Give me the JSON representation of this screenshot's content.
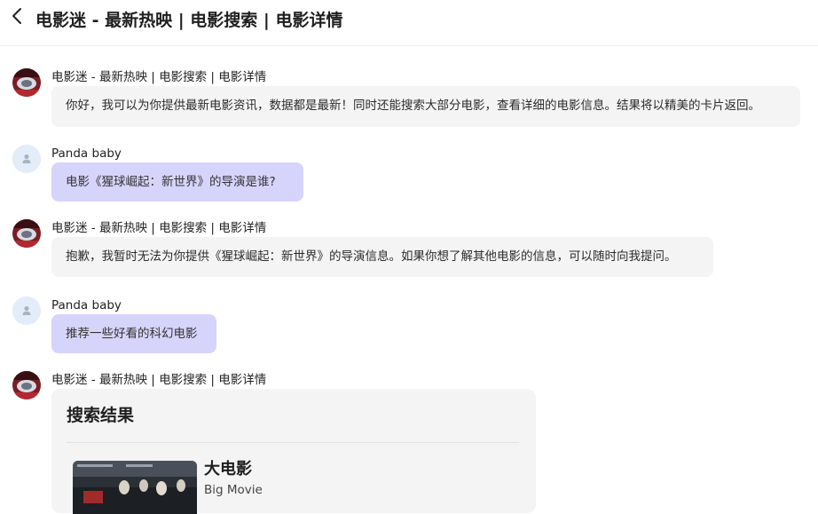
{
  "header": {
    "title": "电影迷 - 最新热映 | 电影搜索 | 电影详情"
  },
  "messages": [
    {
      "sender": "电影迷 - 最新热映 | 电影搜索 | 电影详情",
      "text": "你好，我可以为你提供最新电影资讯，数据都是最新！同时还能搜索大部分电影，查看详细的电影信息。结果将以精美的卡片返回。"
    },
    {
      "sender": "Panda baby",
      "text": "电影《猩球崛起：新世界》的导演是谁?"
    },
    {
      "sender": "电影迷 - 最新热映 | 电影搜索 | 电影详情",
      "text": "抱歉，我暂时无法为你提供《猩球崛起：新世界》的导演信息。如果你想了解其他电影的信息，可以随时向我提问。"
    },
    {
      "sender": "Panda baby",
      "text": "推荐一些好看的科幻电影"
    },
    {
      "sender": "电影迷 - 最新热映 | 电影搜索 | 电影详情"
    }
  ],
  "search_card": {
    "title": "搜索结果",
    "results": [
      {
        "title": "大电影",
        "subtitle": "Big Movie"
      }
    ]
  },
  "colors": {
    "bot_bubble": "#f4f4f5",
    "user_bubble": "#d6d4fb",
    "user_avatar_bg": "#e3ecf9"
  },
  "icons": {
    "back": "chevron-left-icon",
    "bot_avatar": "bot-avatar",
    "user_avatar": "person-icon"
  }
}
